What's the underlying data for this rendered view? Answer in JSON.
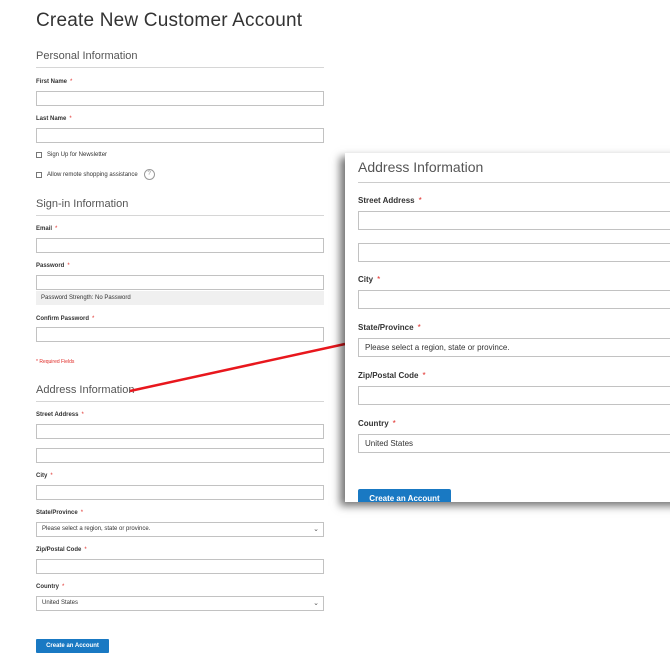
{
  "page": {
    "title": "Create New Customer Account"
  },
  "personal": {
    "section_title": "Personal Information",
    "first_name_label": "First Name",
    "last_name_label": "Last Name",
    "newsletter_label": "Sign Up for Newsletter",
    "remote_assist_label": "Allow remote shopping assistance",
    "help_glyph": "?"
  },
  "signin": {
    "section_title": "Sign-in Information",
    "email_label": "Email",
    "password_label": "Password",
    "password_strength": "Password Strength: No Password",
    "confirm_label": "Confirm Password",
    "required_note": "* Required Fields"
  },
  "address": {
    "section_title": "Address Information",
    "street_label": "Street Address",
    "city_label": "City",
    "state_label": "State/Province",
    "state_value": "Please select a region, state or province.",
    "zip_label": "Zip/Postal Code",
    "country_label": "Country",
    "country_value": "United States"
  },
  "required_marker": "*",
  "submit_label": "Create an Account",
  "colors": {
    "accent": "#1979c3",
    "required": "#e02b27",
    "annotation_arrow": "#e8171d"
  },
  "icons": {
    "chevron": "chevron-down-icon",
    "help": "help-icon",
    "checkbox": "checkbox-icon"
  }
}
